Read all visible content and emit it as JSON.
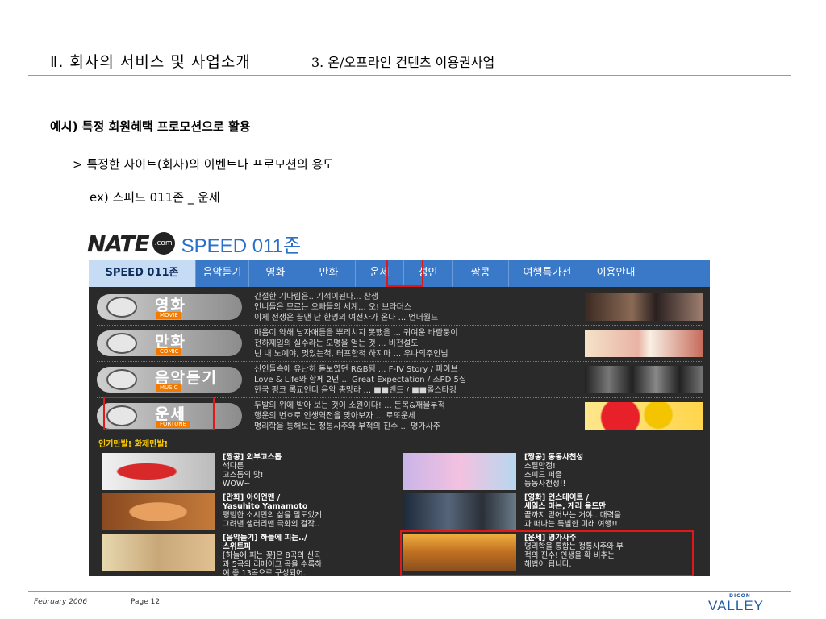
{
  "header": {
    "section_title": "Ⅱ. 회사의 서비스 및 사업소개",
    "section_subtitle": "3. 온/오프라인 컨텐츠 이용권사업"
  },
  "body": {
    "heading": "예시) 특정 회원혜택 프로모션으로 활용",
    "bullet": "> 특정한 사이트(회사)의 이벤트나 프로모션의 용도",
    "example": "ex) 스피드 011존 _ 운세"
  },
  "logo": {
    "brand": "NATE",
    "dot_com": ".com",
    "product": "SPEED 011존"
  },
  "nav": [
    "SPEED 011존",
    "음악듣기",
    "영화",
    "만화",
    "운세",
    "성인",
    "짱콩",
    "여행특가전",
    "이용안내"
  ],
  "categories": [
    {
      "name": "영화",
      "en": "MOVIE",
      "lines": [
        "간절한 기다림은.. 기적이된다... 찬생",
        "언니들은 모르는 오빠들의 세계... 오! 브라더스",
        "이제 전쟁은 끝맨 단 한명의 여전사가 온다 ... 언더월드"
      ]
    },
    {
      "name": "만화",
      "en": "COMIC",
      "lines": [
        "마음이 약해 남자애들을 뿌리치지 못했을 ... 귀여운 바람둥이",
        "천하제일의 실수라는 오명을 얻는 것 ... 비천설도",
        "넌 내 노예야, 멋있는척, 터프한척 하지마 ... 우나의주인님"
      ]
    },
    {
      "name": "음악듣기",
      "en": "MUSIC",
      "lines": [
        "신인들속에 유난히 돋보였던 R&B팀 ... F-IV Story / 파이브",
        "Love & Life와 함께 2년 ... Great Expectation / 조PD 5집",
        "한국 펑크 록교인디 음악 총망라 ... ■■밴드 / ■■롤스타킹"
      ]
    },
    {
      "name": "운세",
      "en": "FORTUNE",
      "lines": [
        "두발의 위에 받아 보는 것이 소원이다! ... 돈복&재물부적",
        "행운의 번호로 인생역전을 맞아보자 ... 로또운세",
        "명리학을 통해보는 정통사주와 부적의 진수 ... 명가사주"
      ]
    }
  ],
  "hot_title": "인기만발! 화제만발!",
  "hot_items": [
    {
      "title": "[짱콩] 외부고스톱",
      "lines": [
        "색다른",
        "고스톱의 맛!",
        "WOW~"
      ]
    },
    {
      "title": "[짱콩] 동동사천성",
      "lines": [
        "스릴만점!",
        "스피드 퍼즐",
        "동동사천성!!"
      ]
    },
    {
      "title": "[만화] 아이언맨 /",
      "lines": [
        "Yasuhito Yamamoto",
        "평범한 소시민의 삶을 밀도있게",
        "그려낸 샐러리맨 극화의 걸작.."
      ]
    },
    {
      "title": "[영화] 인스테이트 /",
      "lines": [
        "세일스 마는, 게리 올드만",
        "끝까지 믿어보는 거야.. 매력을",
        "과 떠나는 특별한 미래 여행!!"
      ]
    },
    {
      "title": "[음악듣기] 하늘에 피는../",
      "lines": [
        "스위트피",
        "[하늘에 피는 꽃]은 8곡의 신곡",
        "과 5곡의 리메이크 곡을 수록하",
        "여 총 13곡으로 구성되어.."
      ]
    },
    {
      "title": "[운세] 명가사주",
      "lines": [
        "명리학을 통합는 정통사주와 부",
        "적의 진수! 인생을 확 비추는",
        "해법이 됩니다."
      ]
    }
  ],
  "footer": {
    "date": "February  2006",
    "page": "Page 12",
    "brand_small": "DICON",
    "brand": "VALLEY"
  },
  "colors": {
    "accent_blue": "#3a78c8",
    "highlight_red": "#e01818",
    "fortune_orange": "#f27a00",
    "brand_blue": "#1f5c9e"
  }
}
